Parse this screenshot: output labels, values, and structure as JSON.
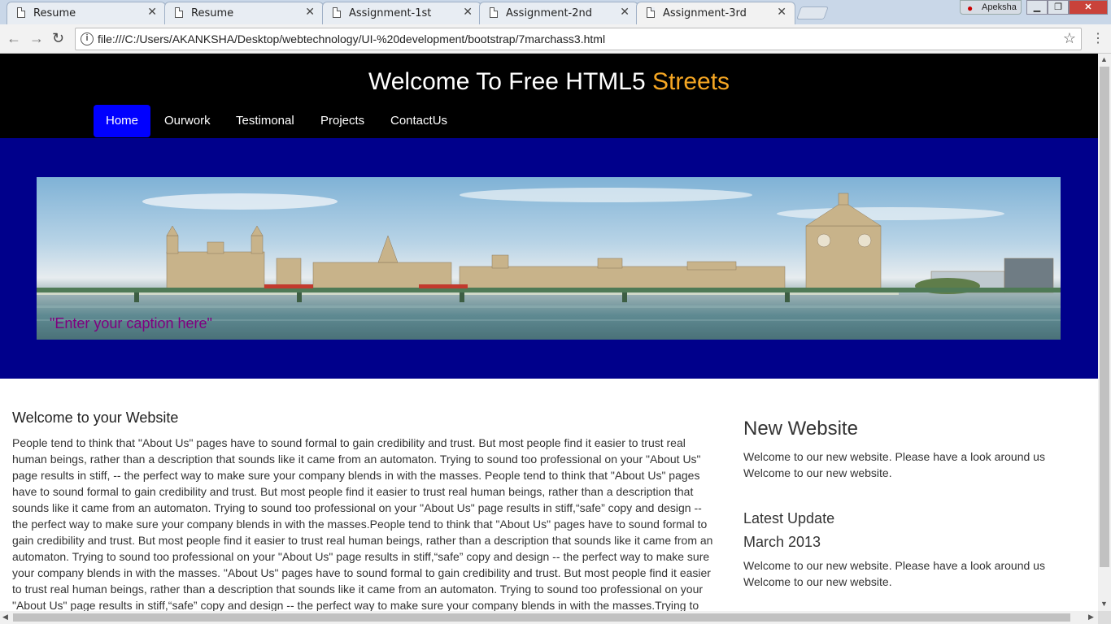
{
  "browser": {
    "tabs": [
      {
        "label": "Resume",
        "active": false
      },
      {
        "label": "Resume",
        "active": false
      },
      {
        "label": "Assignment-1st",
        "active": false
      },
      {
        "label": "Assignment-2nd",
        "active": false
      },
      {
        "label": "Assignment-3rd",
        "active": true
      }
    ],
    "profile_name": "Apeksha",
    "url": "file:///C:/Users/AKANKSHA/Desktop/webtechnology/UI-%20development/bootstrap/7marchass3.html",
    "icons": {
      "back": "arrow-left-icon",
      "forward": "arrow-right-icon",
      "reload": "reload-icon",
      "info": "info-icon",
      "bookmark": "star-icon",
      "menu": "kebab-menu-icon"
    }
  },
  "header": {
    "title_main": "Welcome To Free HTML5",
    "title_accent": "Streets",
    "accent_color": "#f5a623"
  },
  "nav": {
    "items": [
      "Home",
      "Ourwork",
      "Testimonal",
      "Projects",
      "ContactUs"
    ],
    "active_index": 0,
    "active_color": "#0000ff"
  },
  "banner": {
    "caption": "\"Enter your caption here\"",
    "background_color": "#00008b"
  },
  "main": {
    "heading": "Welcome to your Website",
    "body": "People tend to think that \"About Us\" pages have to sound formal to gain credibility and trust. But most people find it easier to trust real human beings, rather than a description that sounds like it came from an automaton. Trying to sound too professional on your \"About Us\" page results in stiff, -- the perfect way to make sure your company blends in with the masses. People tend to think that \"About Us\" pages have to sound formal to gain credibility and trust. But most people find it easier to trust real human beings, rather than a description that sounds like it came from an automaton. Trying to sound too professional on your \"About Us\" page results in stiff,“safe” copy and design -- the perfect way to make sure your company blends in with the masses.People tend to think that \"About Us\" pages have to sound formal to gain credibility and trust. But most people find it easier to trust real human beings, rather than a description that sounds like it came from an automaton. Trying to sound too professional on your \"About Us\" page results in stiff,“safe” copy and design -- the perfect way to make sure your company blends in with the masses. \"About Us\" pages have to sound formal to gain credibility and trust. But most people find it easier to trust real human beings, rather than a description that sounds like it came from an automaton. Trying to sound too professional on your \"About Us\" page results in stiff,“safe” copy and design -- the perfect way to make sure your company blends in with the masses.Trying to"
  },
  "sidebar": {
    "heading": "New Website",
    "text": "Welcome to our new website. Please have a look around us Welcome to our new website.",
    "update_heading": "Latest Update",
    "update_date": "March 2013",
    "update_text": "Welcome to our new website. Please have a look around us Welcome to our new website."
  }
}
